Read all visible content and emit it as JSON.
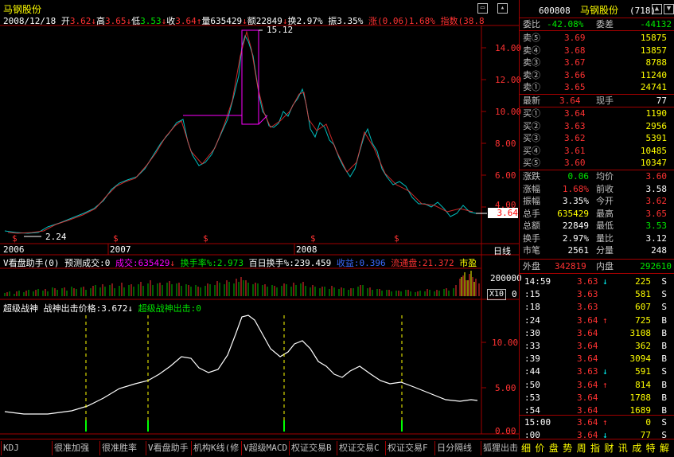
{
  "header": {
    "title": "马钢股份",
    "date": "2008/12/18",
    "open_label": "开",
    "open_value": "3.62",
    "high_label": "高",
    "high_value": "3.65",
    "low_label": "低",
    "low_value": "3.53",
    "close_label": "收",
    "close_value": "3.64",
    "volume_label": "量",
    "volume_value": "635429",
    "amount_label": "额",
    "amount_value": "22849",
    "turnover_label": "换",
    "turnover_value": "2.97%",
    "amplitude_label": "振",
    "amplitude_value": "3.35%",
    "change_label": "涨",
    "change_value": "(0.06)1.68%",
    "index_label": "指数",
    "index_value": "(38.8"
  },
  "price_chart": {
    "peak_label": "15.12",
    "low_label": "2.24",
    "current_price_tag": "3.64",
    "y_ticks": [
      "14.00",
      "12.00",
      "10.00",
      "8.00",
      "6.00",
      "4.00"
    ],
    "x_labels": [
      "2006",
      "2007",
      "2008"
    ],
    "period_label": "日线",
    "markers": [
      "$",
      "$",
      "$",
      "$",
      "$"
    ]
  },
  "volume_panel": {
    "indicator_name": "V看盘助手(0)",
    "predict_label": "预测成交:0",
    "volume_label": "成交:635429",
    "turnover_label": "换手率%:2.973",
    "hundred_day_label": "百日换手%:239.459",
    "profit_label": "收益:0.396",
    "float_label": "流通盘:21.372",
    "market_label": "市盈",
    "y_tick": "200000",
    "unit": "X10",
    "zero": "0"
  },
  "indicator_panel": {
    "name": "超级战神",
    "price_label": "战神出击价格:3.672",
    "signal_label": "超级战神出击:0",
    "y_ticks": [
      "10.00",
      "5.00",
      "0.00"
    ]
  },
  "quote": {
    "code": "600808",
    "name": "马钢股份",
    "num": "(718)",
    "weibi_label": "委比",
    "weibi_value": "-42.08%",
    "weicha_label": "委差",
    "weicha_value": "-44132",
    "sells": [
      {
        "label": "卖⑤",
        "price": "3.69",
        "vol": "15875"
      },
      {
        "label": "卖④",
        "price": "3.68",
        "vol": "13857"
      },
      {
        "label": "卖③",
        "price": "3.67",
        "vol": "8788"
      },
      {
        "label": "卖②",
        "price": "3.66",
        "vol": "11240"
      },
      {
        "label": "卖①",
        "price": "3.65",
        "vol": "24741"
      }
    ],
    "latest_label": "最新",
    "latest_value": "3.64",
    "hand_label": "现手",
    "hand_value": "77",
    "buys": [
      {
        "label": "买①",
        "price": "3.64",
        "vol": "1190"
      },
      {
        "label": "买②",
        "price": "3.63",
        "vol": "2956"
      },
      {
        "label": "买③",
        "price": "3.62",
        "vol": "5391"
      },
      {
        "label": "买④",
        "price": "3.61",
        "vol": "10485"
      },
      {
        "label": "买⑤",
        "price": "3.60",
        "vol": "10347"
      }
    ],
    "stats": [
      {
        "l1": "涨跌",
        "v1": "0.06",
        "l2": "均价",
        "v2": "3.60"
      },
      {
        "l1": "涨幅",
        "v1": "1.68%",
        "l2": "前收",
        "v2": "3.58"
      },
      {
        "l1": "振幅",
        "v1": "3.35%",
        "l2": "今开",
        "v2": "3.62"
      },
      {
        "l1": "总手",
        "v1": "635429",
        "l2": "最高",
        "v2": "3.65"
      },
      {
        "l1": "总额",
        "v1": "22849",
        "l2": "最低",
        "v2": "3.53"
      },
      {
        "l1": "换手",
        "v1": "2.97%",
        "l2": "量比",
        "v2": "3.12"
      },
      {
        "l1": "市笔",
        "v1": "2561",
        "l2": "分量",
        "v2": "248"
      }
    ],
    "outer_label": "外盘",
    "outer_value": "342819",
    "inner_label": "内盘",
    "inner_value": "292610"
  },
  "ticks": [
    {
      "time": "14:59",
      "price": "3.63",
      "dir": "↓",
      "vol": "225",
      "side": "S"
    },
    {
      "time": ":15",
      "price": "3.63",
      "dir": "",
      "vol": "581",
      "side": "S"
    },
    {
      "time": ":18",
      "price": "3.63",
      "dir": "",
      "vol": "607",
      "side": "S"
    },
    {
      "time": ":24",
      "price": "3.64",
      "dir": "↑",
      "vol": "725",
      "side": "B"
    },
    {
      "time": ":30",
      "price": "3.64",
      "dir": "",
      "vol": "3108",
      "side": "B"
    },
    {
      "time": ":33",
      "price": "3.64",
      "dir": "",
      "vol": "362",
      "side": "B"
    },
    {
      "time": ":39",
      "price": "3.64",
      "dir": "",
      "vol": "3094",
      "side": "B"
    },
    {
      "time": ":44",
      "price": "3.63",
      "dir": "↓",
      "vol": "591",
      "side": "S"
    },
    {
      "time": ":50",
      "price": "3.64",
      "dir": "↑",
      "vol": "814",
      "side": "B"
    },
    {
      "time": ":53",
      "price": "3.64",
      "dir": "",
      "vol": "1788",
      "side": "B"
    },
    {
      "time": ":54",
      "price": "3.64",
      "dir": "",
      "vol": "1689",
      "side": "B"
    },
    {
      "time": "15:00",
      "price": "3.64",
      "dir": "↑",
      "vol": "0",
      "side": "S"
    },
    {
      "time": ":00",
      "price": "3.64",
      "dir": "↓",
      "vol": "77",
      "side": "S"
    }
  ],
  "bottom_tabs": [
    "KDJ",
    "很准加强",
    "很准胜率",
    "V看盘助手",
    "机构K线(修",
    "V超级MACD",
    "权证交易B",
    "权证交易C",
    "权证交易F",
    "日分隔线",
    "狐狸出击"
  ],
  "right_tabs": [
    "细",
    "价",
    "盘",
    "势",
    "周",
    "指",
    "财",
    "讯",
    "成",
    "特",
    "解"
  ],
  "icons": {
    "window": "window-icon",
    "pin": "pin-icon",
    "scroll_up": "arrow-up-icon",
    "scroll_down": "arrow-down-icon"
  }
}
